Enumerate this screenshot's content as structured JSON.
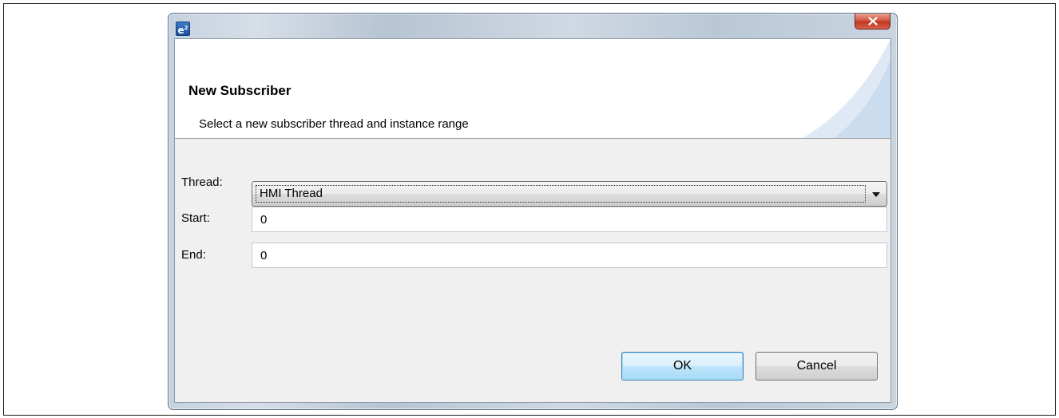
{
  "window": {
    "app_icon": "e",
    "app_icon_superscript": "2",
    "close_glyph": "x"
  },
  "banner": {
    "title": "New Subscriber",
    "description": "Select a new subscriber thread and instance range"
  },
  "form": {
    "thread_label": "Thread:",
    "thread_value": "HMI Thread",
    "start_label": "Start:",
    "start_value": "0",
    "end_label": "End:",
    "end_value": "0"
  },
  "buttons": {
    "ok_label": "OK",
    "cancel_label": "Cancel"
  },
  "icons": {
    "app": "eclipse-e2-icon",
    "close": "close-icon",
    "dropdown": "chevron-down-icon"
  },
  "colors": {
    "close_button": "#c0341f",
    "ok_focus_border": "#3c7fb1",
    "dialog_background": "#f0f0f0"
  }
}
